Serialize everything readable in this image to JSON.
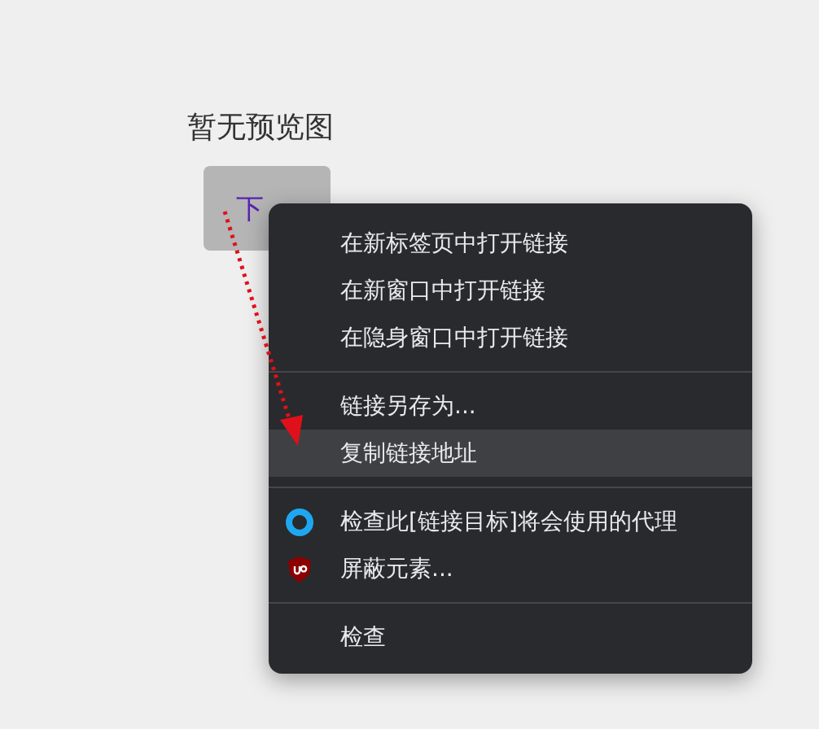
{
  "heading": "暂无预览图",
  "download_button": {
    "label": "下"
  },
  "context_menu": {
    "groups": [
      {
        "items": [
          {
            "label": "在新标签页中打开链接",
            "kind": "plain",
            "selected": false
          },
          {
            "label": "在新窗口中打开链接",
            "kind": "plain",
            "selected": false
          },
          {
            "label": "在隐身窗口中打开链接",
            "kind": "plain",
            "selected": false
          }
        ]
      },
      {
        "items": [
          {
            "label": "链接另存为...",
            "kind": "plain",
            "selected": false
          },
          {
            "label": "复制链接地址",
            "kind": "plain",
            "selected": true
          }
        ]
      },
      {
        "items": [
          {
            "label": "检查此[链接目标]将会使用的代理",
            "kind": "ring",
            "selected": false
          },
          {
            "label": "屏蔽元素...",
            "kind": "shield",
            "selected": false
          }
        ]
      },
      {
        "items": [
          {
            "label": "检查",
            "kind": "plain",
            "selected": false
          }
        ]
      }
    ]
  }
}
